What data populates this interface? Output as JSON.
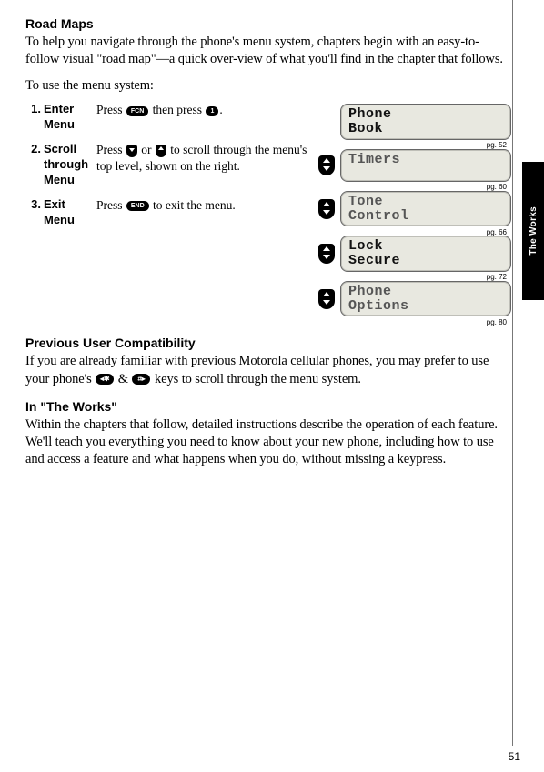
{
  "side_tab": "The Works",
  "page_number": "51",
  "sections": {
    "roadmaps": {
      "title": "Road Maps",
      "intro": "To help you navigate through the phone's menu system, chapters begin with an easy-to-follow visual \"road map\"—a quick over-view of what you'll find in the chapter that follows.",
      "lead": "To use the menu system:",
      "steps": [
        {
          "num": "1.",
          "label": "Enter Menu",
          "pre": "Press ",
          "key1": "FCN",
          "mid": " then press ",
          "key2": "1",
          "post": "."
        },
        {
          "num": "2.",
          "label": "Scroll through Menu",
          "pre": "Press ",
          "mid": " or ",
          "post": " to scroll through the menu's top level, shown on the right."
        },
        {
          "num": "3.",
          "label": "Exit Menu",
          "pre": "Press ",
          "key1": "END",
          "post": " to exit the menu."
        }
      ],
      "map": [
        {
          "lines": [
            "Phone",
            "Book"
          ],
          "pg": "pg. 52",
          "nav": false,
          "active": true
        },
        {
          "lines": [
            "Timers"
          ],
          "pg": "pg. 60",
          "nav": true,
          "active": false
        },
        {
          "lines": [
            "Tone",
            "Control"
          ],
          "pg": "pg. 66",
          "nav": true,
          "active": false
        },
        {
          "lines": [
            "Lock",
            "Secure"
          ],
          "pg": "pg. 72",
          "nav": true,
          "active": true
        },
        {
          "lines": [
            "Phone",
            "Options"
          ],
          "pg": "pg. 80",
          "nav": true,
          "active": false
        }
      ]
    },
    "compat": {
      "title": "Previous User Compatibility",
      "pre": "If you are already familiar with previous Motorola cellular phones, you may prefer to use your phone's ",
      "key1": "◂✱",
      "amp": " & ",
      "key2": "#▸",
      "post": " keys to scroll through the menu system."
    },
    "works": {
      "title": "In \"The Works\"",
      "body": "Within the chapters that follow, detailed instructions describe the operation of each feature. We'll teach you everything you need to know about your new phone, including how to use and access a feature and what happens when you do, without missing a keypress."
    }
  }
}
